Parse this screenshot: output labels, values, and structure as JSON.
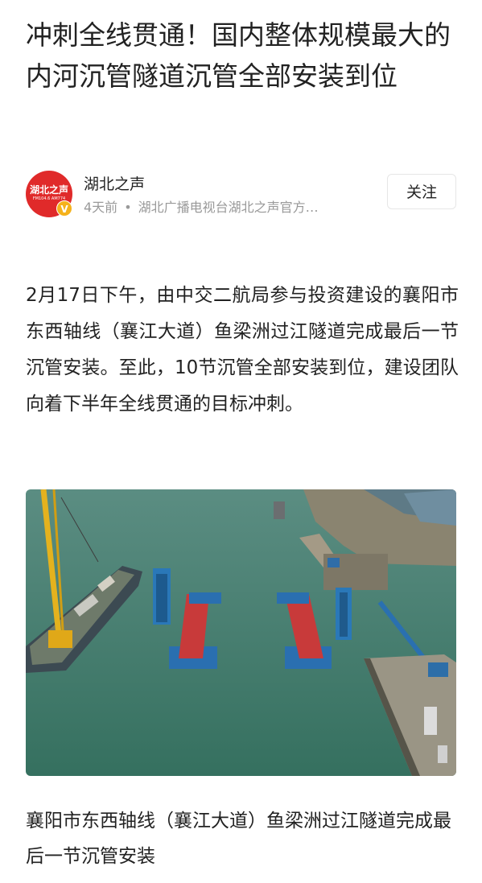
{
  "article": {
    "title": "冲刺全线贯通！国内整体规模最大的内河沉管隧道沉管全部安装到位",
    "author": {
      "name": "湖北之声",
      "avatar_text": "湖北之声",
      "avatar_subtext": "FM104.6 AM774",
      "verified_badge": "V",
      "time": "4天前",
      "separator": "•",
      "source": "湖北广播电视台湖北之声官方…"
    },
    "follow_label": "关注",
    "paragraph": "2月17日下午，由中交二航局参与投资建设的襄阳市东西轴线（襄江大道）鱼梁洲过江隧道完成最后一节沉管安装。至此，10节沉管全部安装到位，建设团队向着下半年全线贯通的目标冲刺。",
    "caption": "襄阳市东西轴线（襄江大道）鱼梁洲过江隧道完成最后一节沉管安装"
  },
  "colors": {
    "brand_red": "#e02a2a",
    "badge_gold": "#f5b21c",
    "meta_gray": "#999999",
    "river_green": "#3f7a6c"
  }
}
